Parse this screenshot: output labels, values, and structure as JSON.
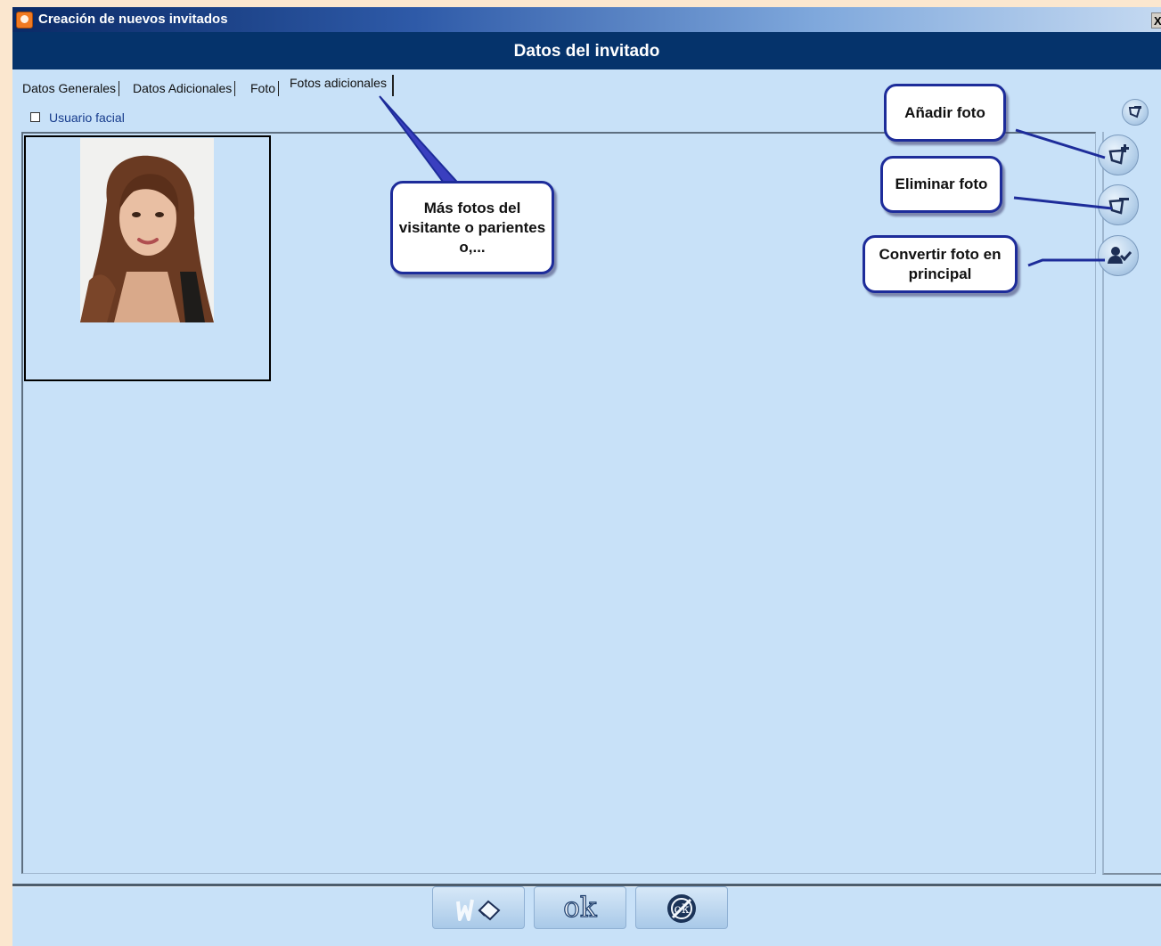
{
  "window": {
    "title": "Creación de nuevos invitados",
    "close_label": "X",
    "header": "Datos del invitado"
  },
  "tabs": [
    {
      "label": "Datos Generales",
      "active": false
    },
    {
      "label": "Datos Adicionales",
      "active": false
    },
    {
      "label": "Foto",
      "active": false
    },
    {
      "label": "Fotos adicionales",
      "active": true
    }
  ],
  "facial": {
    "label": "Usuario facial",
    "checked": false
  },
  "side_buttons": [
    {
      "name": "add-photo",
      "icon": "add-photo-icon"
    },
    {
      "name": "remove-photo",
      "icon": "remove-photo-icon"
    },
    {
      "name": "set-main-photo",
      "icon": "user-check-icon"
    }
  ],
  "callouts": {
    "more_photos": "Más fotos del visitante o parientes o,...",
    "add_photo": "Añadir foto",
    "remove_photo": "Eliminar foto",
    "set_main": "Convertir foto en principal"
  },
  "bottom_buttons": {
    "clear_icon": "clear-eraser-icon",
    "ok_label": "ok",
    "cancel_icon": "cancel-ok-icon"
  },
  "colors": {
    "window_bg": "#c8e1f8",
    "header_bg": "#05336b",
    "callout_border": "#1d2c9a",
    "app_icon": "#f07a22"
  }
}
